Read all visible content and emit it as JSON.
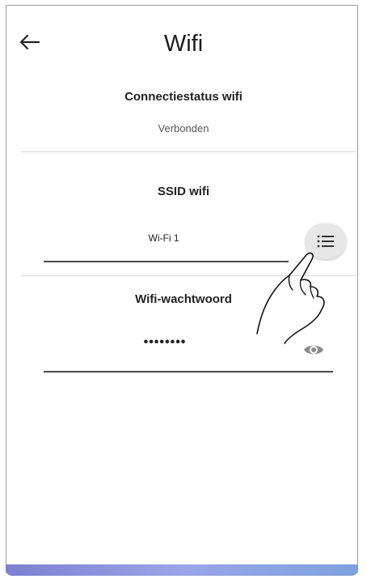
{
  "header": {
    "title": "Wifi",
    "back_icon": "arrow-left-icon"
  },
  "connection_status": {
    "label": "Connectiestatus wifi",
    "value": "Verbonden"
  },
  "ssid": {
    "label": "SSID wifi",
    "value": "Wi-Fi 1",
    "list_icon": "list-icon"
  },
  "password": {
    "label": "Wifi-wachtwoord",
    "value": "••••••••",
    "visibility_icon": "eye-icon"
  },
  "overlay": {
    "pointer_icon": "hand-pointer-icon"
  },
  "colors": {
    "accent_bottom": "#8a94de",
    "button_bg": "#e7e7e7",
    "divider": "#d6d6d6",
    "field_line": "#4a4a4a"
  }
}
